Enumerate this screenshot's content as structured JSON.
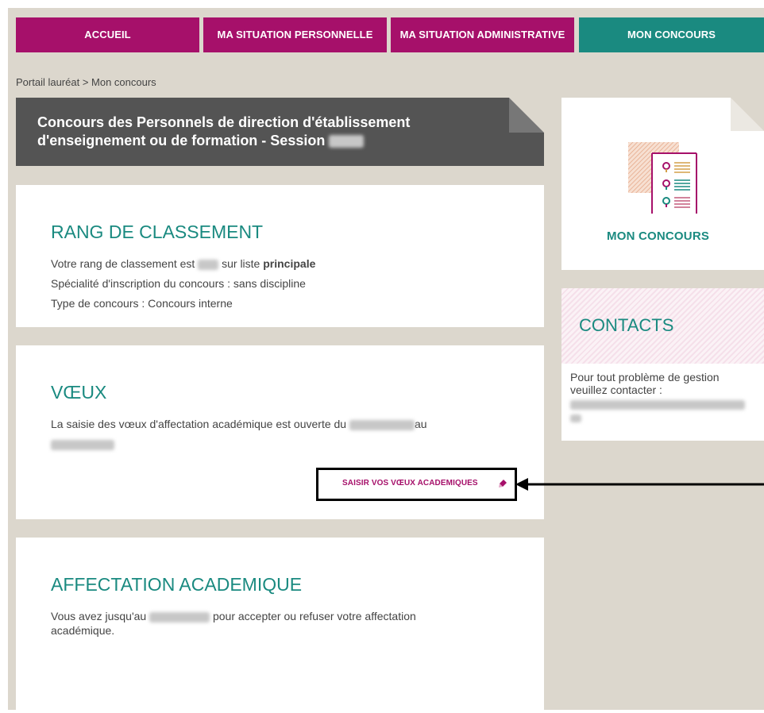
{
  "nav": {
    "items": [
      {
        "label": "ACCUEIL"
      },
      {
        "label": "MA SITUATION PERSONNELLE"
      },
      {
        "label": "MA SITUATION ADMINISTRATIVE"
      },
      {
        "label": "MON CONCOURS"
      }
    ]
  },
  "breadcrumb": "Portail lauréat > Mon concours",
  "banner": {
    "title": "Concours des Personnels de direction d'établissement d'enseignement ou de formation - Session"
  },
  "rang": {
    "title": "RANG DE CLASSEMENT",
    "line1_prefix": "Votre rang de classement est",
    "line1_mid": "sur liste",
    "line1_bold": "principale",
    "line2": "Spécialité d'inscription du concours : sans discipline",
    "line3": "Type de concours : Concours interne"
  },
  "voeux": {
    "title": "VŒUX",
    "text_prefix": "La saisie des vœux d'affectation académique est ouverte du",
    "text_mid": "au",
    "action": "SAISIR VOS VŒUX ACADEMIQUES"
  },
  "affectation": {
    "title": "AFFECTATION ACADEMIQUE",
    "text_prefix": "Vous avez jusqu'au",
    "text_suffix": "pour accepter ou refuser votre affectation académique."
  },
  "side": {
    "label": "MON CONCOURS"
  },
  "contacts": {
    "title": "CONTACTS",
    "text": "Pour tout problème de gestion veuillez contacter :"
  },
  "colors": {
    "purple": "#a6106a",
    "teal": "#1a8a80",
    "banner": "#545454",
    "background": "#dcd7cd"
  }
}
